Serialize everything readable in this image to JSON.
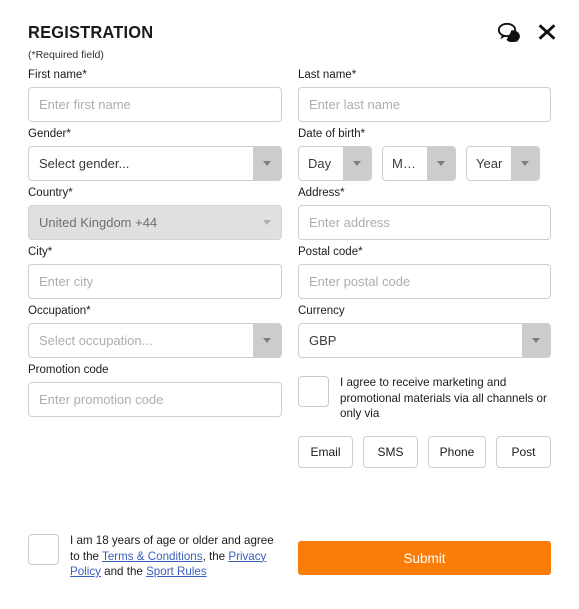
{
  "header": {
    "title": "REGISTRATION",
    "required_note": "(*Required field)",
    "chat_icon": "chat-bubbles-icon",
    "close_icon": "close-icon"
  },
  "fields": {
    "first_name": {
      "label": "First name*",
      "placeholder": "Enter first name",
      "value": ""
    },
    "last_name": {
      "label": "Last name*",
      "placeholder": "Enter last name",
      "value": ""
    },
    "gender": {
      "label": "Gender*",
      "value": "Select gender..."
    },
    "dob": {
      "label": "Date of birth*",
      "day": "Day",
      "month": "Month",
      "year": "Year"
    },
    "country": {
      "label": "Country*",
      "value": "United Kingdom +44",
      "disabled": true
    },
    "address": {
      "label": "Address*",
      "placeholder": "Enter address",
      "value": ""
    },
    "city": {
      "label": "City*",
      "placeholder": "Enter city",
      "value": ""
    },
    "postal_code": {
      "label": "Postal code*",
      "placeholder": "Enter postal code",
      "value": ""
    },
    "occupation": {
      "label": "Occupation*",
      "value": "Select occupation..."
    },
    "currency": {
      "label": "Currency",
      "value": "GBP"
    },
    "promotion_code": {
      "label": "Promotion code",
      "placeholder": "Enter promotion code",
      "value": ""
    }
  },
  "marketing": {
    "consent_text": "I agree to receive marketing and promotional materials via all channels or only via",
    "channels": [
      "Email",
      "SMS",
      "Phone",
      "Post"
    ]
  },
  "terms": {
    "prefix": "I am 18 years of age or older and agree to the ",
    "link1": "Terms & Conditions",
    "mid1": ", the ",
    "link2": "Privacy Policy",
    "mid2": " and the ",
    "link3": "Sport Rules"
  },
  "submit": {
    "label": "Submit"
  },
  "colors": {
    "accent": "#fa7d09",
    "link": "#3b5fc0",
    "border": "#cfcfcf",
    "disabled_bg": "#e0e0e0",
    "placeholder": "#aeaeae"
  }
}
